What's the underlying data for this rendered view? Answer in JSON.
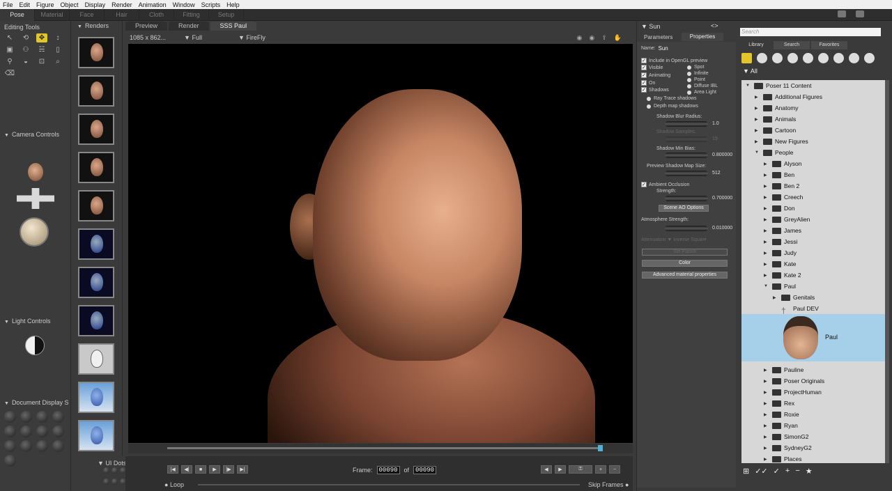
{
  "menu": [
    "File",
    "Edit",
    "Figure",
    "Object",
    "Display",
    "Render",
    "Animation",
    "Window",
    "Scripts",
    "Help"
  ],
  "rooms": [
    "Pose",
    "Material",
    "Face",
    "Hair",
    "Cloth",
    "Fitting",
    "Setup"
  ],
  "left_panel": {
    "editing_tools_title": "Editing Tools",
    "camera_controls_title": "Camera Controls",
    "light_controls_title": "Light Controls",
    "document_display_title": "Document Display S",
    "ui_dots_title": "UI Dots"
  },
  "renders_title": "Renders",
  "doc_tabs": [
    "Preview",
    "Render",
    "SSS Paul"
  ],
  "doc_bar": {
    "size": "1085 x 862...",
    "quality": "Full",
    "renderer": "FireFly"
  },
  "timeline": {
    "frame_label": "Frame:",
    "frame": "00090",
    "of_label": "of",
    "total": "00090",
    "loop_label": "Loop",
    "skip_frames_label": "Skip Frames"
  },
  "props": {
    "title": "Sun",
    "tab_parameters": "Parameters",
    "tab_properties": "Properties",
    "name_label": "Name:",
    "name_value": "Sun",
    "checks": [
      "Include in OpenGL preview",
      "Visible",
      "Animating",
      "On",
      "Shadows"
    ],
    "light_types": [
      "Spot",
      "Infinite",
      "Point",
      "Diffuse IBL",
      "Area Light"
    ],
    "shadow_modes": [
      "Ray Trace shadows",
      "Depth map shadows"
    ],
    "shadow_blur_label": "Shadow Blur Radius:",
    "shadow_blur_value": "1.0",
    "shadow_samples_label": "Shadow Samples:",
    "shadow_samples_value": "19",
    "shadow_min_bias_label": "Shadow Min Bias:",
    "shadow_min_bias_value": "0.800000",
    "preview_map_label": "Preview Shadow Map Size:",
    "preview_map_value": "512",
    "ao_label": "Ambient Occlusion",
    "strength_label": "Strength:",
    "strength_value": "0.700000",
    "scene_ao_button": "Scene AO Options",
    "atmosphere_label": "Atmosphere Strength:",
    "atmosphere_value": "0.010000",
    "attenuation_label": "Attenuation",
    "attenuation_value": "Inverse Square",
    "set_parent_button": "Set Parent",
    "color_button": "Color",
    "advanced_button": "Advanced material properties"
  },
  "library": {
    "search_placeholder": "Search",
    "tabs": [
      "Library",
      "Search",
      "Favorites"
    ],
    "filter_all": "All",
    "tree": [
      {
        "label": "Poser 11 Content",
        "level": 0,
        "open": true
      },
      {
        "label": "Additional Figures",
        "level": 1
      },
      {
        "label": "Anatomy",
        "level": 1
      },
      {
        "label": "Animals",
        "level": 1
      },
      {
        "label": "Cartoon",
        "level": 1
      },
      {
        "label": "New Figures",
        "level": 1
      },
      {
        "label": "People",
        "level": 1,
        "open": true
      },
      {
        "label": "Alyson",
        "level": 2
      },
      {
        "label": "Ben",
        "level": 2
      },
      {
        "label": "Ben 2",
        "level": 2
      },
      {
        "label": "Creech",
        "level": 2
      },
      {
        "label": "Don",
        "level": 2
      },
      {
        "label": "GreyAlien",
        "level": 2
      },
      {
        "label": "James",
        "level": 2
      },
      {
        "label": "Jessi",
        "level": 2
      },
      {
        "label": "Judy",
        "level": 2
      },
      {
        "label": "Kate",
        "level": 2
      },
      {
        "label": "Kate 2",
        "level": 2
      },
      {
        "label": "Paul",
        "level": 2,
        "open": true
      },
      {
        "label": "Genitals",
        "level": 3
      },
      {
        "label": "Paul DEV",
        "level": 3,
        "figure": true
      }
    ],
    "selected_item": "Paul",
    "tree_after": [
      "Pauline",
      "Poser Originals",
      "ProjectHuman",
      "Rex",
      "Roxie",
      "Ryan",
      "SimonG2",
      "SydneyG2",
      "Places"
    ]
  }
}
